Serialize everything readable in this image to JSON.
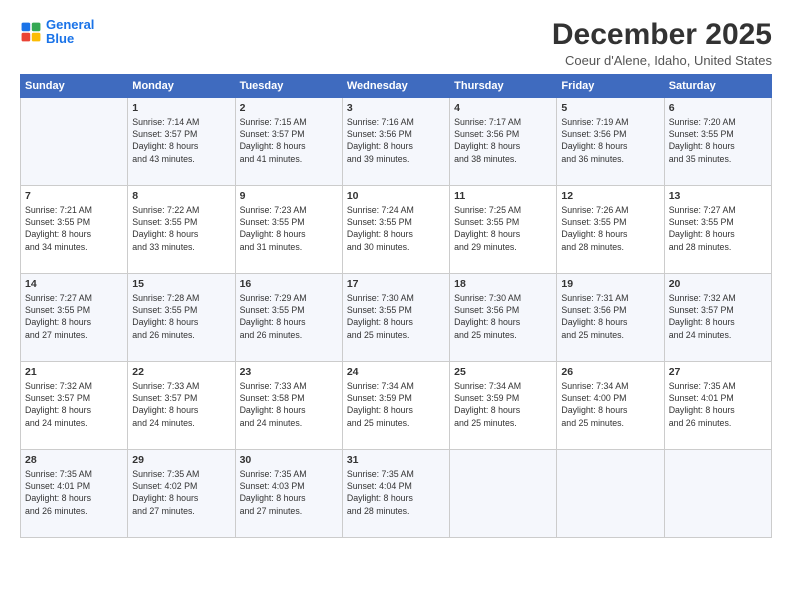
{
  "logo": {
    "line1": "General",
    "line2": "Blue"
  },
  "title": "December 2025",
  "subtitle": "Coeur d'Alene, Idaho, United States",
  "days_of_week": [
    "Sunday",
    "Monday",
    "Tuesday",
    "Wednesday",
    "Thursday",
    "Friday",
    "Saturday"
  ],
  "weeks": [
    [
      {
        "day": "",
        "content": ""
      },
      {
        "day": "1",
        "content": "Sunrise: 7:14 AM\nSunset: 3:57 PM\nDaylight: 8 hours\nand 43 minutes."
      },
      {
        "day": "2",
        "content": "Sunrise: 7:15 AM\nSunset: 3:57 PM\nDaylight: 8 hours\nand 41 minutes."
      },
      {
        "day": "3",
        "content": "Sunrise: 7:16 AM\nSunset: 3:56 PM\nDaylight: 8 hours\nand 39 minutes."
      },
      {
        "day": "4",
        "content": "Sunrise: 7:17 AM\nSunset: 3:56 PM\nDaylight: 8 hours\nand 38 minutes."
      },
      {
        "day": "5",
        "content": "Sunrise: 7:19 AM\nSunset: 3:56 PM\nDaylight: 8 hours\nand 36 minutes."
      },
      {
        "day": "6",
        "content": "Sunrise: 7:20 AM\nSunset: 3:55 PM\nDaylight: 8 hours\nand 35 minutes."
      }
    ],
    [
      {
        "day": "7",
        "content": "Sunrise: 7:21 AM\nSunset: 3:55 PM\nDaylight: 8 hours\nand 34 minutes."
      },
      {
        "day": "8",
        "content": "Sunrise: 7:22 AM\nSunset: 3:55 PM\nDaylight: 8 hours\nand 33 minutes."
      },
      {
        "day": "9",
        "content": "Sunrise: 7:23 AM\nSunset: 3:55 PM\nDaylight: 8 hours\nand 31 minutes."
      },
      {
        "day": "10",
        "content": "Sunrise: 7:24 AM\nSunset: 3:55 PM\nDaylight: 8 hours\nand 30 minutes."
      },
      {
        "day": "11",
        "content": "Sunrise: 7:25 AM\nSunset: 3:55 PM\nDaylight: 8 hours\nand 29 minutes."
      },
      {
        "day": "12",
        "content": "Sunrise: 7:26 AM\nSunset: 3:55 PM\nDaylight: 8 hours\nand 28 minutes."
      },
      {
        "day": "13",
        "content": "Sunrise: 7:27 AM\nSunset: 3:55 PM\nDaylight: 8 hours\nand 28 minutes."
      }
    ],
    [
      {
        "day": "14",
        "content": "Sunrise: 7:27 AM\nSunset: 3:55 PM\nDaylight: 8 hours\nand 27 minutes."
      },
      {
        "day": "15",
        "content": "Sunrise: 7:28 AM\nSunset: 3:55 PM\nDaylight: 8 hours\nand 26 minutes."
      },
      {
        "day": "16",
        "content": "Sunrise: 7:29 AM\nSunset: 3:55 PM\nDaylight: 8 hours\nand 26 minutes."
      },
      {
        "day": "17",
        "content": "Sunrise: 7:30 AM\nSunset: 3:55 PM\nDaylight: 8 hours\nand 25 minutes."
      },
      {
        "day": "18",
        "content": "Sunrise: 7:30 AM\nSunset: 3:56 PM\nDaylight: 8 hours\nand 25 minutes."
      },
      {
        "day": "19",
        "content": "Sunrise: 7:31 AM\nSunset: 3:56 PM\nDaylight: 8 hours\nand 25 minutes."
      },
      {
        "day": "20",
        "content": "Sunrise: 7:32 AM\nSunset: 3:57 PM\nDaylight: 8 hours\nand 24 minutes."
      }
    ],
    [
      {
        "day": "21",
        "content": "Sunrise: 7:32 AM\nSunset: 3:57 PM\nDaylight: 8 hours\nand 24 minutes."
      },
      {
        "day": "22",
        "content": "Sunrise: 7:33 AM\nSunset: 3:57 PM\nDaylight: 8 hours\nand 24 minutes."
      },
      {
        "day": "23",
        "content": "Sunrise: 7:33 AM\nSunset: 3:58 PM\nDaylight: 8 hours\nand 24 minutes."
      },
      {
        "day": "24",
        "content": "Sunrise: 7:34 AM\nSunset: 3:59 PM\nDaylight: 8 hours\nand 25 minutes."
      },
      {
        "day": "25",
        "content": "Sunrise: 7:34 AM\nSunset: 3:59 PM\nDaylight: 8 hours\nand 25 minutes."
      },
      {
        "day": "26",
        "content": "Sunrise: 7:34 AM\nSunset: 4:00 PM\nDaylight: 8 hours\nand 25 minutes."
      },
      {
        "day": "27",
        "content": "Sunrise: 7:35 AM\nSunset: 4:01 PM\nDaylight: 8 hours\nand 26 minutes."
      }
    ],
    [
      {
        "day": "28",
        "content": "Sunrise: 7:35 AM\nSunset: 4:01 PM\nDaylight: 8 hours\nand 26 minutes."
      },
      {
        "day": "29",
        "content": "Sunrise: 7:35 AM\nSunset: 4:02 PM\nDaylight: 8 hours\nand 27 minutes."
      },
      {
        "day": "30",
        "content": "Sunrise: 7:35 AM\nSunset: 4:03 PM\nDaylight: 8 hours\nand 27 minutes."
      },
      {
        "day": "31",
        "content": "Sunrise: 7:35 AM\nSunset: 4:04 PM\nDaylight: 8 hours\nand 28 minutes."
      },
      {
        "day": "",
        "content": ""
      },
      {
        "day": "",
        "content": ""
      },
      {
        "day": "",
        "content": ""
      }
    ]
  ]
}
